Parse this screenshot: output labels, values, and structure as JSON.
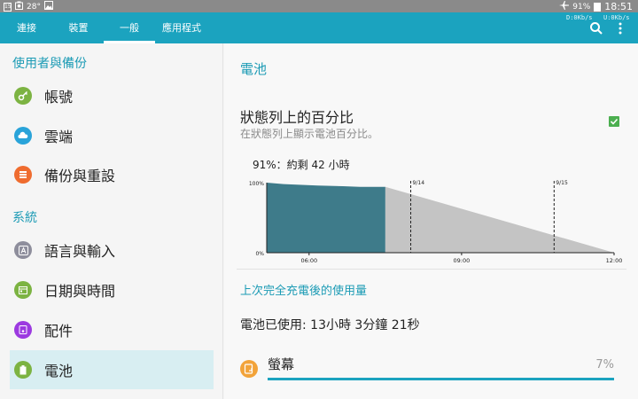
{
  "status_bar": {
    "left_badge": "15",
    "temperature": "28°",
    "battery_percent": "91%",
    "time": "18:51",
    "icons": [
      "notification-icon",
      "camera-icon",
      "image-icon",
      "airplane-icon",
      "battery-icon"
    ]
  },
  "app_bar": {
    "tabs": [
      {
        "label": "連接",
        "active": false
      },
      {
        "label": "裝置",
        "active": false
      },
      {
        "label": "一般",
        "active": true
      },
      {
        "label": "應用程式",
        "active": false
      }
    ],
    "download_speed": "D:0Kb/s",
    "upload_speed": "U:0Kb/s",
    "icons": [
      "search-icon",
      "more-vert-icon"
    ]
  },
  "sidebar": {
    "sections": [
      {
        "title": "使用者與備份",
        "items": [
          {
            "label": "帳號",
            "icon": "key-icon",
            "color": "#7cb342"
          },
          {
            "label": "雲端",
            "icon": "cloud-icon",
            "color": "#29a3d9"
          },
          {
            "label": "備份與重設",
            "icon": "backup-icon",
            "color": "#ef6c2f"
          }
        ]
      },
      {
        "title": "系統",
        "items": [
          {
            "label": "語言與輸入",
            "icon": "language-icon",
            "color": "#8e8e9c"
          },
          {
            "label": "日期與時間",
            "icon": "calendar-icon",
            "color": "#7cb342"
          },
          {
            "label": "配件",
            "icon": "accessory-icon",
            "color": "#9c3ae0"
          },
          {
            "label": "電池",
            "icon": "battery-icon",
            "color": "#7cb342",
            "selected": true
          }
        ]
      }
    ]
  },
  "main": {
    "title": "電池",
    "percentage_option": {
      "title": "狀態列上的百分比",
      "subtitle": "在狀態列上顯示電池百分比。",
      "checked": true
    },
    "battery_summary": "91%：約剩 42 小時",
    "usage_title": "上次完全充電後的使用量",
    "battery_used": "電池已使用: 13小時 3分鐘 21秒",
    "apps": [
      {
        "name": "螢幕",
        "percent": "7%",
        "fraction": 0.07,
        "icon": "screen-icon",
        "color": "#f2a33a"
      }
    ]
  },
  "chart_data": {
    "type": "area",
    "y_tick_labels": [
      "100%",
      "0%"
    ],
    "x_tick_labels": [
      "06:00",
      "09:00",
      "12:00"
    ],
    "date_markers": [
      "9/14",
      "9/15"
    ],
    "ylim": [
      0,
      100
    ],
    "series": [
      {
        "kind": "actual",
        "color": "#3e7b8a",
        "x": [
          "05:10",
          "05:30",
          "06:10",
          "06:40",
          "07:00",
          "07:30"
        ],
        "values": [
          100,
          98,
          96,
          95,
          94,
          94
        ]
      },
      {
        "kind": "projected",
        "color": "#c4c4c4",
        "x": [
          "07:30",
          "12:00"
        ],
        "values": [
          94,
          0
        ]
      }
    ],
    "grid": false
  }
}
